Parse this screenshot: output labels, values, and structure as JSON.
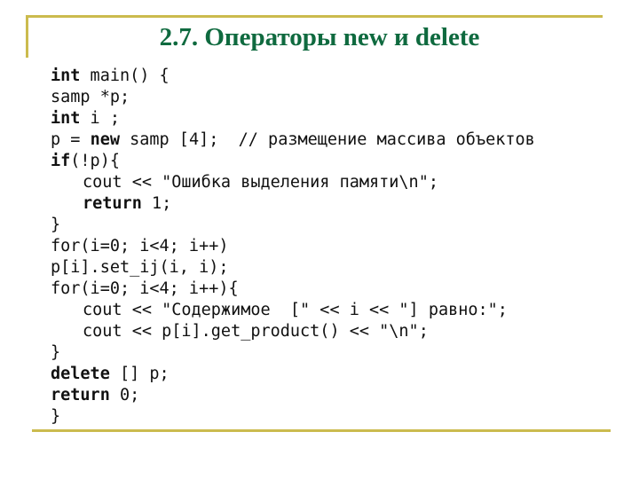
{
  "slide": {
    "title": "2.7. Операторы new и delete",
    "colors": {
      "title": "#0f6a3f",
      "frame": "#cbbb4e",
      "code_text": "#111111"
    }
  },
  "code": {
    "language": "C++",
    "lines": [
      {
        "indent": 0,
        "tokens": [
          {
            "t": "int",
            "kw": true
          },
          {
            "t": " main() {"
          }
        ]
      },
      {
        "indent": 0,
        "tokens": [
          {
            "t": "samp *p;"
          }
        ]
      },
      {
        "indent": 0,
        "tokens": [
          {
            "t": "int",
            "kw": true
          },
          {
            "t": " i ;"
          }
        ]
      },
      {
        "indent": 0,
        "tokens": [
          {
            "t": "p = "
          },
          {
            "t": "new",
            "kw": true
          },
          {
            "t": " samp [4];  // размещение массива объектов"
          }
        ]
      },
      {
        "indent": 0,
        "tokens": [
          {
            "t": "if",
            "kw": true
          },
          {
            "t": "(!p){"
          }
        ]
      },
      {
        "indent": 1,
        "tokens": [
          {
            "t": "cout << \"Ошибка выделения памяти\\n\";"
          }
        ]
      },
      {
        "indent": 1,
        "tokens": [
          {
            "t": "return",
            "kw": true
          },
          {
            "t": " 1;"
          }
        ]
      },
      {
        "indent": 0,
        "tokens": [
          {
            "t": "}"
          }
        ]
      },
      {
        "indent": 0,
        "tokens": [
          {
            "t": "for(i=0; i<4; i++)"
          }
        ]
      },
      {
        "indent": 0,
        "tokens": [
          {
            "t": "p[i].set_ij(i, i);"
          }
        ]
      },
      {
        "indent": 0,
        "tokens": [
          {
            "t": "for(i=0; i<4; i++){"
          }
        ]
      },
      {
        "indent": 1,
        "tokens": [
          {
            "t": "cout << \"Содержимое  [\" << i << \"] равно:\";"
          }
        ]
      },
      {
        "indent": 1,
        "tokens": [
          {
            "t": "cout << p[i].get_product() << \"\\n\";"
          }
        ]
      },
      {
        "indent": 0,
        "tokens": [
          {
            "t": "}"
          }
        ]
      },
      {
        "indent": 0,
        "tokens": [
          {
            "t": "delete",
            "kw": true
          },
          {
            "t": " [] p;"
          }
        ]
      },
      {
        "indent": 0,
        "tokens": [
          {
            "t": "return",
            "kw": true
          },
          {
            "t": " 0;"
          }
        ]
      },
      {
        "indent": 0,
        "tokens": [
          {
            "t": "}"
          }
        ]
      }
    ]
  }
}
